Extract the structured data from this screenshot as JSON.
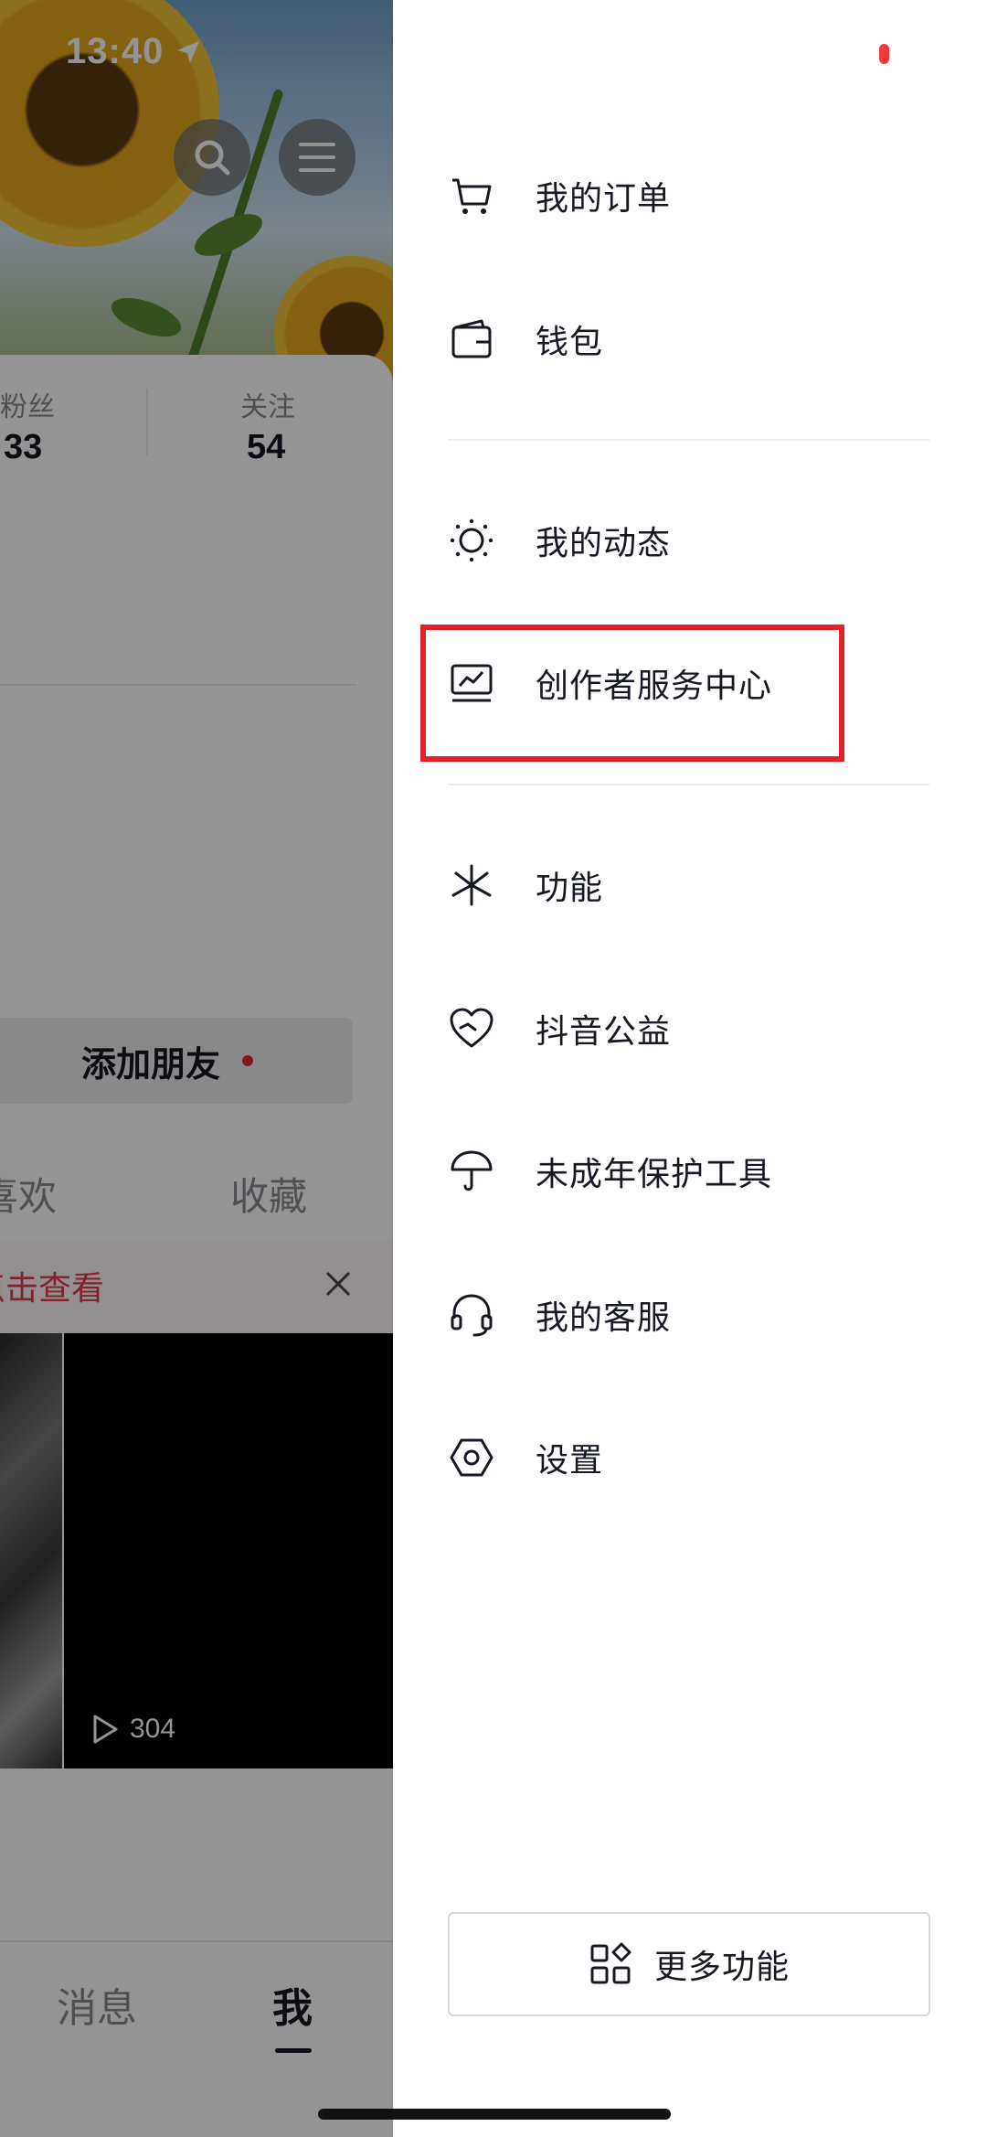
{
  "status": {
    "time": "13:40"
  },
  "profile": {
    "stats": [
      {
        "label": "粉丝",
        "value": "33"
      },
      {
        "label": "关注",
        "value": "54"
      }
    ],
    "add_friend": "添加朋友",
    "tabs": [
      "喜欢",
      "收藏"
    ],
    "notice": "点击查看",
    "video_play_count": "304",
    "bottom_nav": {
      "messages": "消息",
      "me": "我"
    }
  },
  "drawer": {
    "menu": [
      {
        "label": "我的订单",
        "icon": "cart-icon"
      },
      {
        "label": "钱包",
        "icon": "wallet-icon"
      },
      {
        "label": "我的动态",
        "icon": "sun-icon"
      },
      {
        "label": "创作者服务中心",
        "icon": "creator-chart-icon",
        "highlighted": true
      },
      {
        "label": "功能",
        "icon": "sparkle-icon"
      },
      {
        "label": "抖音公益",
        "icon": "charity-heart-icon"
      },
      {
        "label": "未成年保护工具",
        "icon": "umbrella-icon"
      },
      {
        "label": "我的客服",
        "icon": "headset-icon"
      },
      {
        "label": "设置",
        "icon": "hexagon-settings-icon"
      }
    ],
    "more_button": "更多功能"
  },
  "colors": {
    "accent_red": "#e3212c",
    "notice_red": "#e23b50",
    "text": "#161823"
  }
}
